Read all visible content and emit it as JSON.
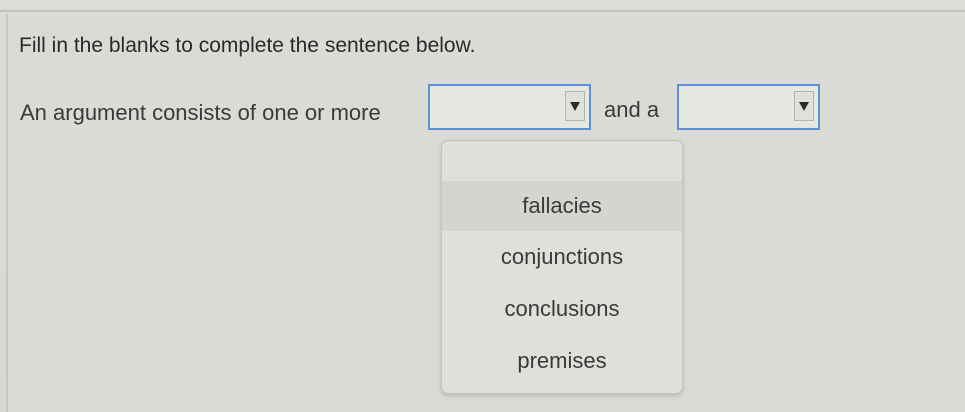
{
  "instruction": "Fill in the blanks to complete the sentence below.",
  "sentence": {
    "part1": "An argument consists of one or more",
    "part2": "and a"
  },
  "blanks": [
    {
      "value": ""
    },
    {
      "value": ""
    }
  ],
  "dropdown": {
    "options": [
      "fallacies",
      "conjunctions",
      "conclusions",
      "premises"
    ],
    "highlighted": "fallacies"
  },
  "colors": {
    "focus_border": "#5b8fd6",
    "background": "#dadad6"
  }
}
